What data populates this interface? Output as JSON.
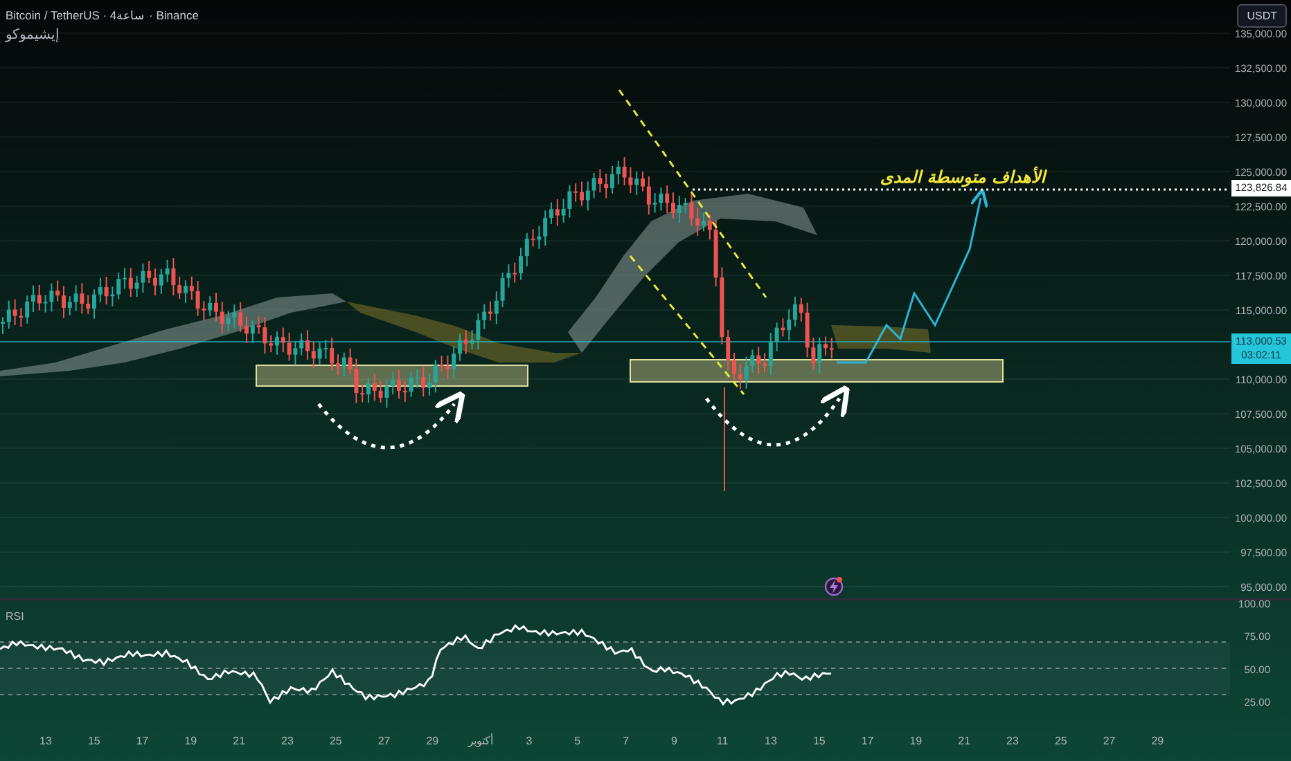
{
  "header": {
    "title": "Bitcoin / TetherUS · 4ساعة · Binance",
    "indicator": "إيشيموكو"
  },
  "currency_button": "USDT",
  "price_axis": [
    "135,000.00",
    "132,500.00",
    "130,000.00",
    "127,500.00",
    "125,000.00",
    "122,500.00",
    "120,000.00",
    "117,500.00",
    "115,000.00",
    "110,000.00",
    "107,500.00",
    "105,000.00",
    "102,500.00",
    "100,000.00",
    "97,500.00",
    "95,000.00"
  ],
  "target_price": "123,826.84",
  "current_price": {
    "price": "113,000.53",
    "countdown": "03:02:11"
  },
  "annotation": "الأهداف متوسطة المدى",
  "rsi": {
    "title": "RSI",
    "axis": [
      "100.00",
      "75.00",
      "50.00",
      "25.00"
    ]
  },
  "time_axis": [
    "13",
    "15",
    "17",
    "19",
    "21",
    "23",
    "25",
    "27",
    "29",
    "أكتوبر",
    "3",
    "5",
    "7",
    "9",
    "11",
    "13",
    "15",
    "17",
    "19",
    "21",
    "23",
    "25",
    "27",
    "29"
  ]
}
